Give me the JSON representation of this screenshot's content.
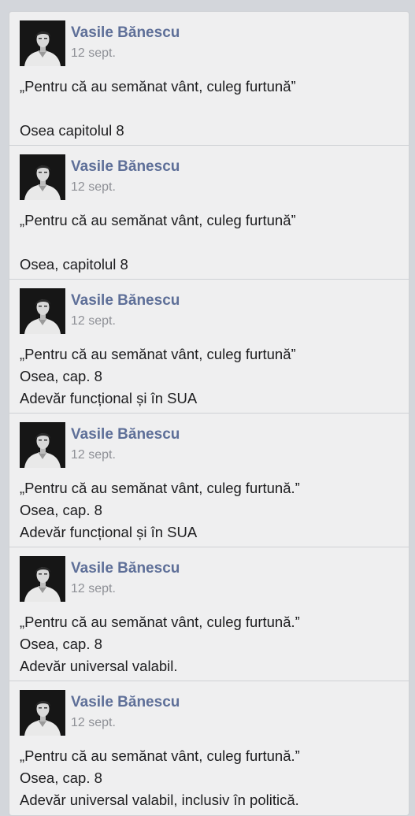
{
  "posts": [
    {
      "author": "Vasile Bănescu",
      "date": "12 sept.",
      "lines": [
        "„Pentru că au semănat vânt, culeg furtună”",
        "",
        "Osea capitolul 8"
      ]
    },
    {
      "author": "Vasile Bănescu",
      "date": "12 sept.",
      "lines": [
        "„Pentru că au semănat vânt, culeg furtună”",
        "",
        "Osea, capitolul 8"
      ]
    },
    {
      "author": "Vasile Bănescu",
      "date": "12 sept.",
      "lines": [
        "„Pentru că au semănat vânt, culeg furtună”",
        "Osea, cap. 8",
        "Adevăr funcțional și în SUA"
      ]
    },
    {
      "author": "Vasile Bănescu",
      "date": "12 sept.",
      "lines": [
        "„Pentru că au semănat vânt, culeg furtună.”",
        "Osea, cap. 8",
        "Adevăr funcțional și în SUA"
      ]
    },
    {
      "author": "Vasile Bănescu",
      "date": "12 sept.",
      "lines": [
        "„Pentru că au semănat vânt, culeg furtună.”",
        "Osea, cap. 8",
        "Adevăr universal valabil."
      ]
    },
    {
      "author": "Vasile Bănescu",
      "date": "12 sept.",
      "lines": [
        "„Pentru că au semănat vânt, culeg furtună.”",
        "Osea, cap. 8",
        "Adevăr universal valabil, inclusiv în politică."
      ]
    }
  ],
  "colors": {
    "author": "#5e6f98",
    "date": "#8e9096",
    "text": "#1d1d1f",
    "card": "#efeff0",
    "background": "#d3d6db"
  },
  "icons": {
    "avatar": "profile-photo-icon"
  }
}
